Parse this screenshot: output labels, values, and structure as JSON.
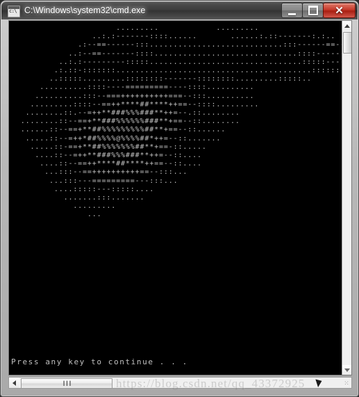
{
  "window": {
    "title": "C:\\Windows\\system32\\cmd.exe",
    "icon_name": "cmd-icon",
    "icon_label": "c:\\",
    "controls": {
      "minimize_label": "Minimize",
      "maximize_label": "Maximize",
      "close_label": "Close",
      "close_glyph": "✕"
    },
    "colors": {
      "titlebar": "#3b3b3b",
      "close_button": "#c5392a",
      "console_background": "#000000",
      "console_foreground": "#c0c0c0",
      "frame": "#b9b9b9"
    }
  },
  "console": {
    "ascii_art": "                      .........            .........\n                 ..:.:-------::::......       ......:.::-------:.:..\n              .:--==------:::............................:::------==--:..\n            ..:--==-------::::..............................::::-------==--:..\n          ..:.:---------:::::................................:::::---------:.:..\n         .:.::-:::::::.........................................:::::::-:::.:.\n        ..:::::.........::::::::-------::::::::.........:::::..\n      ..........::::----=========----::::..........\n     ..........:::--===++++++++++===--:::..........\n    .........::::--==++****##****++==--::::.........\n   ........::.--=++**###%%%###**++=--.::........\n  ........::--==+**###%%%%%%###**+==--::........\n  ......::--==+**##%%%%%%%%%##**+==--::......\n   .....::--=++*##%%%%@%%%%##*++=--::.......\n    .....::-==+**##%%%%%%%##**+==-::.....\n     ....::--=++**###%%%###**++=--::....\n      ....::--==++****##****++==--::....\n       ...:::--==++++++++++==--:::...\n        ...:::---=========---:::...\n         ....:::::---:::::....\n           .......:::.......\n             .........\n                ...",
    "prompt": "Press any key to continue . . ."
  },
  "scrollbars": {
    "vertical": {
      "up_arrow_name": "scroll-up-arrow",
      "down_arrow_name": "scroll-down-arrow",
      "thumb_name": "vertical-scroll-thumb"
    },
    "horizontal": {
      "left_arrow_name": "scroll-left-arrow",
      "thumb_name": "horizontal-scroll-thumb",
      "grip": "❙❙❙",
      "resize_grip": "⁙"
    }
  },
  "watermark": {
    "text": "https://blog.csdn.net/qq_43372925"
  }
}
